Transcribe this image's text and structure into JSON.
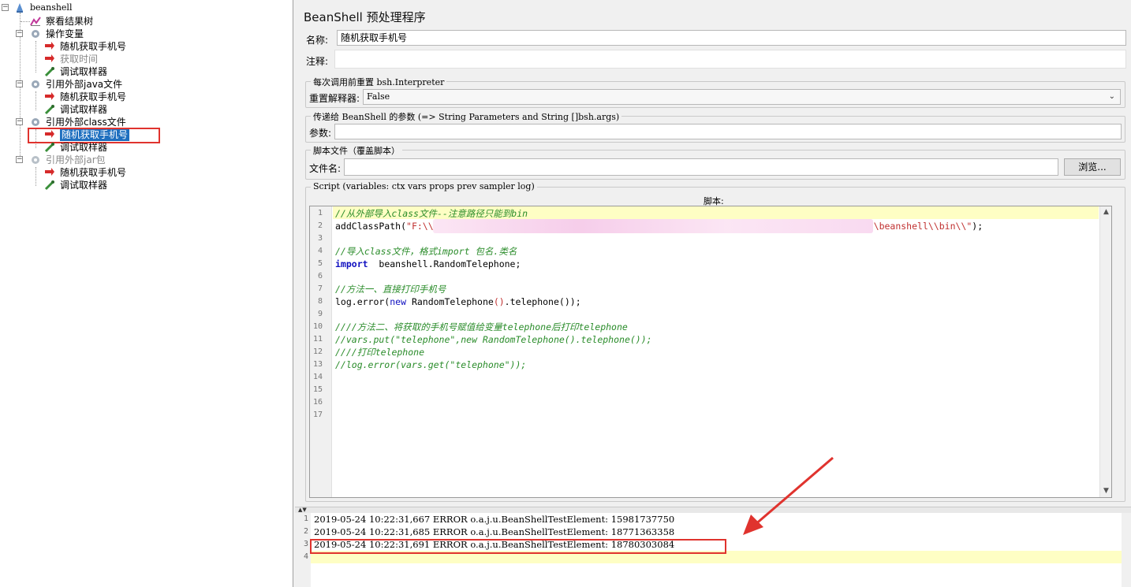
{
  "tree": {
    "root": "beanshell",
    "items": [
      {
        "label": "察看结果树"
      },
      {
        "label": "操作变量"
      },
      {
        "label": "随机获取手机号"
      },
      {
        "label": "获取时间"
      },
      {
        "label": "调试取样器"
      },
      {
        "label": "引用外部java文件"
      },
      {
        "label": "随机获取手机号"
      },
      {
        "label": "调试取样器"
      },
      {
        "label": "引用外部class文件"
      },
      {
        "label": "随机获取手机号"
      },
      {
        "label": "调试取样器"
      },
      {
        "label": "引用外部jar包"
      },
      {
        "label": "随机获取手机号"
      },
      {
        "label": "调试取样器"
      }
    ]
  },
  "panel": {
    "title": "BeanShell 预处理程序",
    "name_label": "名称:",
    "name_value": "随机获取手机号",
    "comment_label": "注释:",
    "comment_value": "",
    "reset_group_title": "每次调用前重置 bsh.Interpreter",
    "reset_label": "重置解释器:",
    "reset_value": "False",
    "params_group_title": "传递给 BeanShell 的参数 (=> String Parameters and String []bsh.args)",
    "params_label": "参数:",
    "params_value": "",
    "file_group_title": "脚本文件（覆盖脚本）",
    "file_label": "文件名:",
    "file_value": "",
    "browse_label": "浏览...",
    "script_group_title": "Script (variables: ctx vars props prev sampler log)",
    "script_header": "脚本:"
  },
  "code": {
    "line_numbers": [
      "1",
      "2",
      "3",
      "4",
      "5",
      "6",
      "7",
      "8",
      "9",
      "10",
      "11",
      "12",
      "13",
      "14",
      "15",
      "16",
      "17"
    ],
    "l1": "//从外部导入class文件--注意路径只能到bin",
    "l2_a": "addClassPath(",
    "l2_b": "\"F:\\\\",
    "l2_c": "\\beanshell\\\\bin\\\\\"",
    "l2_d": ");",
    "l4": "//导入class文件，格式import 包名.类名",
    "l5_kw": "import",
    "l5_rest": "  beanshell.RandomTelephone;",
    "l7": "//方法一、直接打印手机号",
    "l8_a": "log.error(",
    "l8_kw": "new",
    "l8_b": " RandomTelephone",
    "l8_c": "()",
    "l8_d": ".telephone",
    "l8_e": "());",
    "l10": "////方法二、将获取的手机号赋值给变量telephone后打印telephone",
    "l11": "//vars.put(\"telephone\",new RandomTelephone().telephone());",
    "l12": "////打印telephone",
    "l13": "//log.error(vars.get(\"telephone\"));"
  },
  "log": {
    "line_numbers": [
      "1",
      "2",
      "3",
      "4"
    ],
    "lines": [
      "2019-05-24 10:22:31,667 ERROR o.a.j.u.BeanShellTestElement: 15981737750",
      "2019-05-24 10:22:31,685 ERROR o.a.j.u.BeanShellTestElement: 18771363358",
      "2019-05-24 10:22:31,691 ERROR o.a.j.u.BeanShellTestElement: 18780303084"
    ]
  },
  "colors": {
    "selection": "#1e6fbf",
    "annotation_red": "#e0332e",
    "line_highlight": "#fefec4",
    "comment_green": "#2a8c2a",
    "keyword_blue": "#1010c0"
  }
}
